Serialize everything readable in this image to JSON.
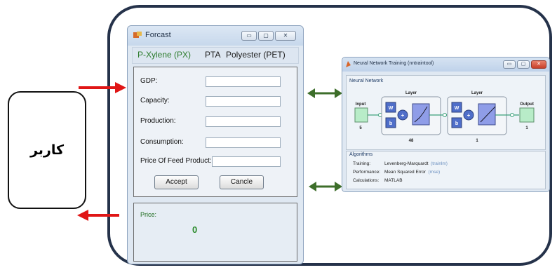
{
  "user": {
    "label": "کاربر"
  },
  "forcast_window": {
    "title": "Forcast",
    "buttons": {
      "minimize": "▭",
      "maximize": "▢",
      "close": "✕"
    },
    "tabs": [
      {
        "label": "P-Xylene (PX)",
        "color": "#2a7a2a"
      },
      {
        "label": "PTA",
        "color": "#1a1a1a"
      },
      {
        "label": "Polyester (PET)",
        "color": "#1a1a1a"
      }
    ],
    "fields": [
      {
        "label": "GDP:",
        "value": ""
      },
      {
        "label": "Capacity:",
        "value": ""
      },
      {
        "label": "Production:",
        "value": ""
      },
      {
        "label": "Consumption:",
        "value": ""
      },
      {
        "label": "Price Of Feed Product:",
        "value": ""
      }
    ],
    "accept_label": "Accept",
    "cancel_label": "Cancle",
    "price_label": "Price:",
    "price_value": "0"
  },
  "nn_window": {
    "title": "Neural Network Training (nntraintool)",
    "network_title": "Neural Network",
    "diagram": {
      "input_label": "Input",
      "input_size": "5",
      "layer1_label": "Layer",
      "layer1_size": "48",
      "layer2_label": "Layer",
      "layer2_size": "1",
      "output_label": "Output",
      "output_size": "1",
      "w_label": "W",
      "b_label": "b",
      "plus": "+"
    },
    "algorithms_title": "Algorithms",
    "algorithms": [
      {
        "key": "Training:",
        "value": "Levenberg-Marquardt",
        "paren": "(trainlm)"
      },
      {
        "key": "Performance:",
        "value": "Mean Squared Error",
        "paren": "(mse)"
      },
      {
        "key": "Calculations:",
        "value": "MATLAB",
        "paren": ""
      }
    ]
  },
  "colors": {
    "frame": "#25324a",
    "red_arrow": "#e01616",
    "green_arrow": "#3d6e2a",
    "price_value": "#2a8a2a"
  }
}
